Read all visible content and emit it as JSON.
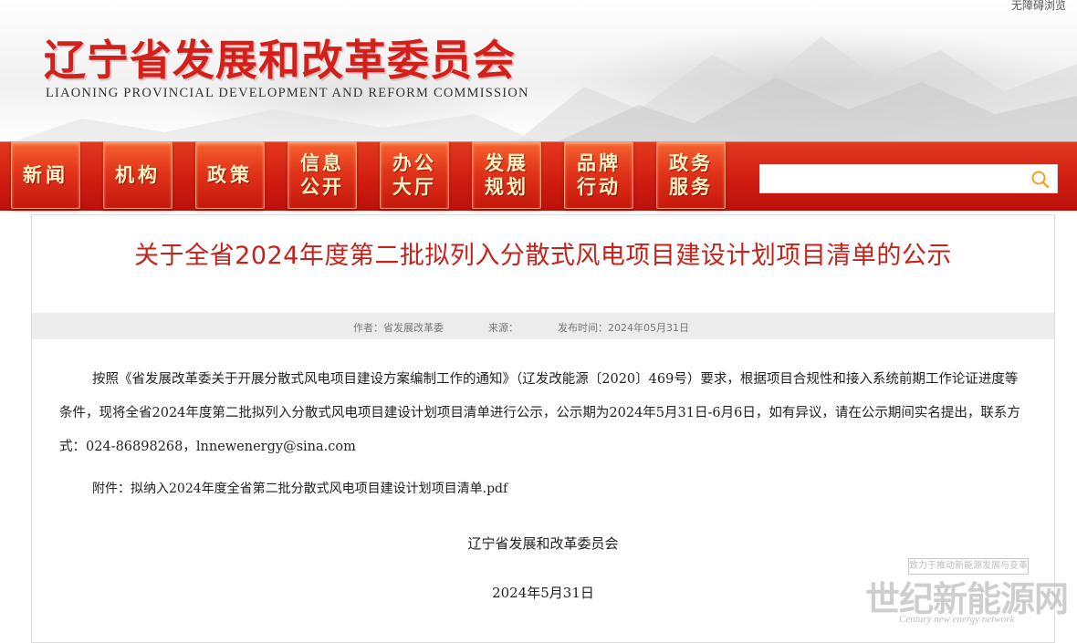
{
  "header": {
    "accessibility_link": "无障碍浏览",
    "site_title": "辽宁省发展和改革委员会",
    "site_subtitle": "LIAONING PROVINCIAL DEVELOPMENT AND REFORM COMMISSION"
  },
  "nav": {
    "items": [
      {
        "label": "新闻"
      },
      {
        "label": "机构"
      },
      {
        "label": "政策"
      },
      {
        "label": "信息公开"
      },
      {
        "label": "办公大厅"
      },
      {
        "label": "发展规划"
      },
      {
        "label": "品牌行动"
      },
      {
        "label": "政务服务"
      }
    ]
  },
  "search": {
    "placeholder": "",
    "icon": "search-icon",
    "icon_color": "#f0a020"
  },
  "article": {
    "title": "关于全省2024年度第二批拟列入分散式风电项目建设计划项目清单的公示",
    "meta": {
      "author": "作者：省发展改革委",
      "source": "来源：",
      "publish_time": "发布时间：2024年05月31日"
    },
    "body": "按照《省发展改革委关于开展分散式风电项目建设方案编制工作的通知》（辽发改能源〔2020〕469号）要求，根据项目合规性和接入系统前期工作论证进度等条件，现将全省2024年度第二批拟列入分散式风电项目建设计划项目清单进行公示，公示期为2024年5月31日-6月6日，如有异议，请在公示期间实名提出，联系方式：024-86898268，lnnewenergy@sina.com",
    "attachment_label": "附件：",
    "attachment_link": "拟纳入2024年度全省第二批分散式风电项目建设计划项目清单.pdf",
    "signature": "辽宁省发展和改革委员会",
    "date": "2024年5月31日"
  },
  "watermark": {
    "tagline": "致力于推动新能源发展与变革",
    "logo": "世纪新能源网",
    "logo_en": "Century new energy network"
  },
  "colors": {
    "brand_red": "#d3201b",
    "title_red": "#c4231b",
    "nav_gold": "#fff3c8"
  }
}
